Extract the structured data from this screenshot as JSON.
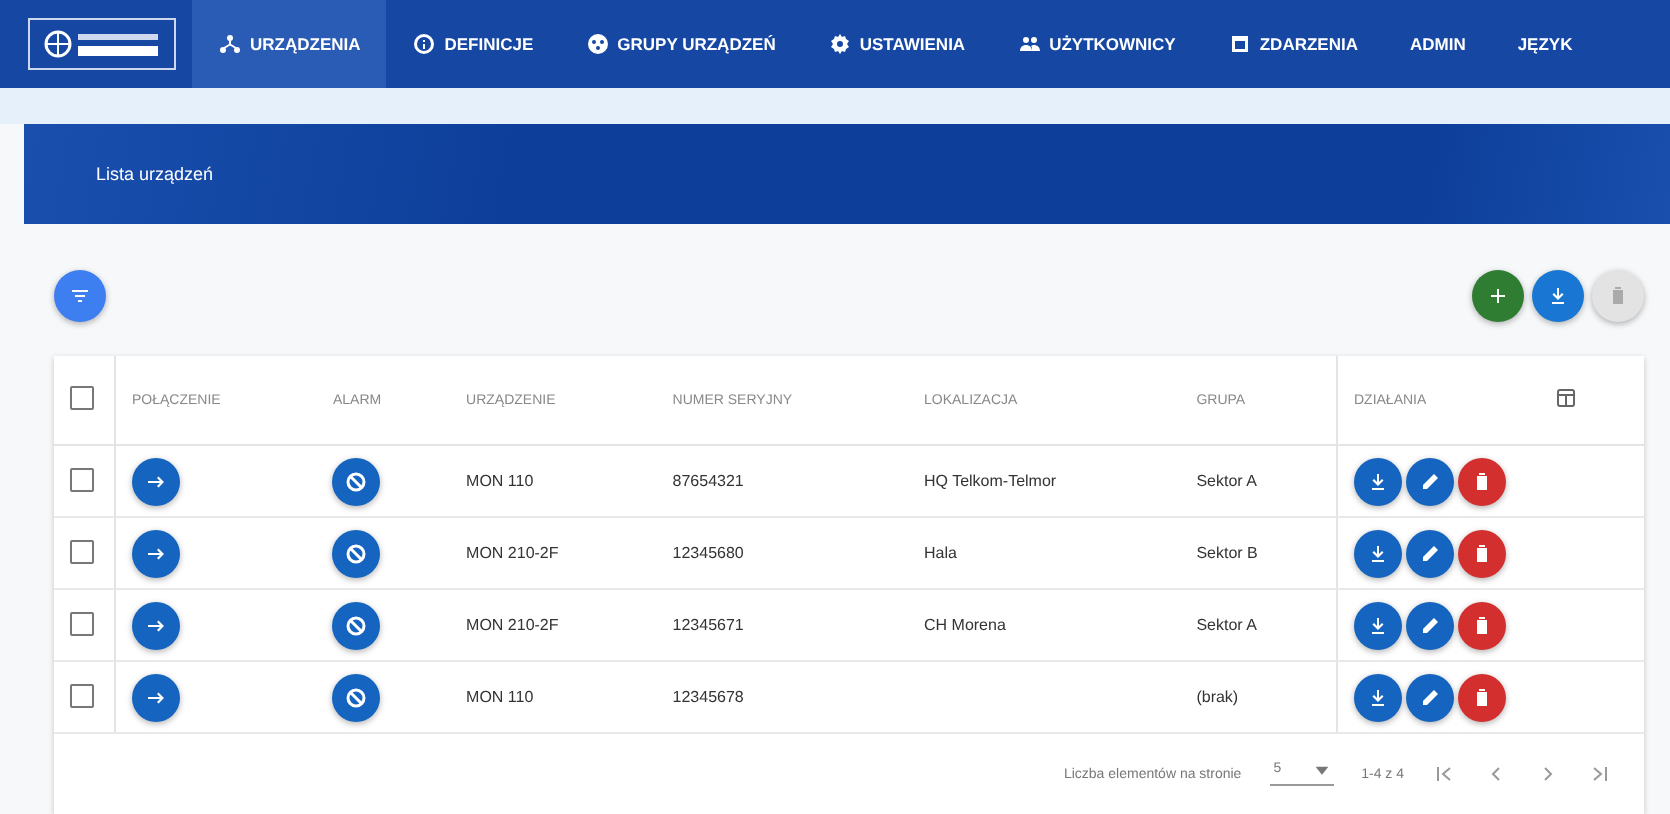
{
  "nav": {
    "items": [
      {
        "label": "URZĄDZENIA",
        "selected": true
      },
      {
        "label": "DEFINICJE",
        "selected": false
      },
      {
        "label": "GRUPY URZĄDZEŃ",
        "selected": false
      },
      {
        "label": "USTAWIENIA",
        "selected": false
      },
      {
        "label": "UŻYTKOWNICY",
        "selected": false
      },
      {
        "label": "ZDARZENIA",
        "selected": false
      },
      {
        "label": "ADMIN",
        "selected": false
      },
      {
        "label": "JĘZYK",
        "selected": false
      }
    ]
  },
  "banner": {
    "title": "Lista urządzeń"
  },
  "toolbar": {
    "actions": [
      {
        "kind": "add",
        "disabled": false
      },
      {
        "kind": "download",
        "disabled": false
      },
      {
        "kind": "delete",
        "disabled": true
      }
    ]
  },
  "table": {
    "all_checked": false,
    "columns": [
      "POŁĄCZENIE",
      "ALARM",
      "URZĄDZENIE",
      "NUMER SERYJNY",
      "LOKALIZACJA",
      "GRUPA",
      "DZIAŁANIA"
    ],
    "rows": [
      {
        "checked": false,
        "device": "MON 110",
        "serial": "87654321",
        "location": "HQ Telkom-Telmor",
        "group": "Sektor A"
      },
      {
        "checked": false,
        "device": "MON 210-2F",
        "serial": "12345680",
        "location": "Hala",
        "group": "Sektor B"
      },
      {
        "checked": false,
        "device": "MON 210-2F",
        "serial": "12345671",
        "location": "CH Morena",
        "group": "Sektor A"
      },
      {
        "checked": false,
        "device": "MON 110",
        "serial": "12345678",
        "location": "",
        "group": "(brak)"
      }
    ]
  },
  "pagination": {
    "label": "Liczba elementów na stronie",
    "page_size": "5",
    "range": "1-4 z 4"
  }
}
